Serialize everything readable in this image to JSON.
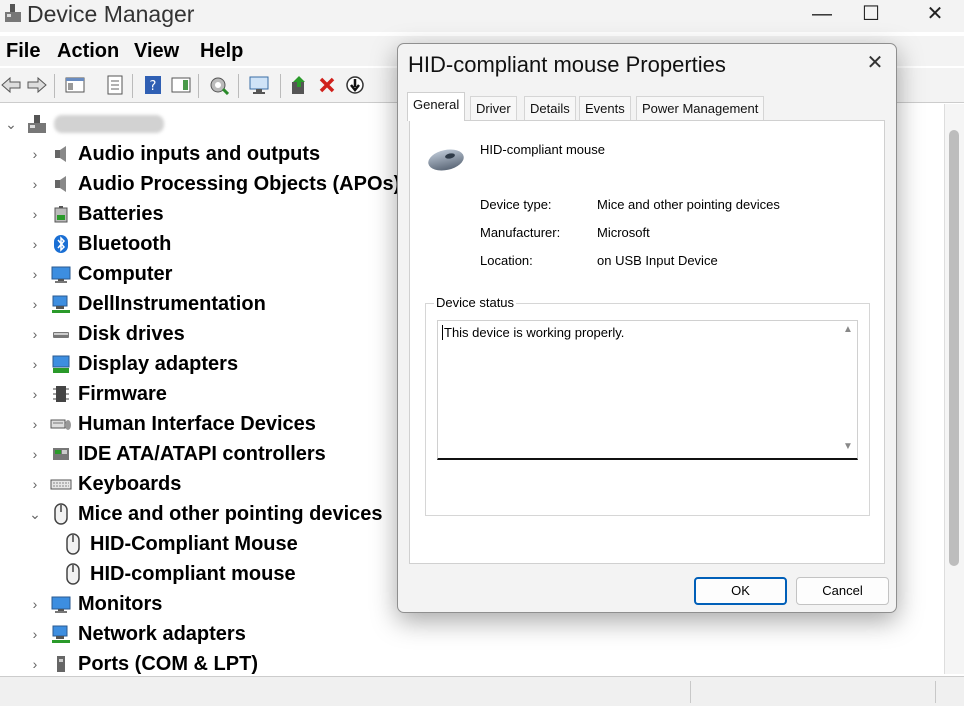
{
  "window": {
    "title": "Device Manager",
    "controls": [
      "—",
      "☐",
      "✕"
    ]
  },
  "menu": [
    "File",
    "Action",
    "View",
    "Help"
  ],
  "tree": {
    "root_label": "",
    "items": [
      {
        "label": "Audio inputs and outputs",
        "icon": "speaker-icon"
      },
      {
        "label": "Audio Processing Objects (APOs)",
        "icon": "speaker-icon"
      },
      {
        "label": "Batteries",
        "icon": "battery-icon"
      },
      {
        "label": "Bluetooth",
        "icon": "bluetooth-icon"
      },
      {
        "label": "Computer",
        "icon": "monitor-icon"
      },
      {
        "label": "DellInstrumentation",
        "icon": "network-icon"
      },
      {
        "label": "Disk drives",
        "icon": "disk-icon"
      },
      {
        "label": "Display adapters",
        "icon": "display-adapter-icon"
      },
      {
        "label": "Firmware",
        "icon": "chip-icon"
      },
      {
        "label": "Human Interface Devices",
        "icon": "hid-icon"
      },
      {
        "label": "IDE ATA/ATAPI controllers",
        "icon": "controller-icon"
      },
      {
        "label": "Keyboards",
        "icon": "keyboard-icon"
      },
      {
        "label": "Mice and other pointing devices",
        "icon": "mouse-icon",
        "expanded": true
      },
      {
        "label": "HID-Compliant Mouse",
        "icon": "mouse-icon",
        "child": true
      },
      {
        "label": "HID-compliant mouse",
        "icon": "mouse-icon",
        "child": true
      },
      {
        "label": "Monitors",
        "icon": "monitor-icon"
      },
      {
        "label": "Network adapters",
        "icon": "network-icon"
      },
      {
        "label": "Ports (COM & LPT)",
        "icon": "port-icon"
      }
    ]
  },
  "dialog": {
    "title": "HID-compliant mouse Properties",
    "tabs": [
      "General",
      "Driver",
      "Details",
      "Events",
      "Power Management"
    ],
    "active_tab": "General",
    "device_name": "HID-compliant mouse",
    "fields": [
      {
        "label": "Device type:",
        "value": "Mice and other pointing devices"
      },
      {
        "label": "Manufacturer:",
        "value": "Microsoft"
      },
      {
        "label": "Location:",
        "value": "on USB Input Device"
      }
    ],
    "status_legend": "Device status",
    "status_text": "This device is working properly.",
    "ok_label": "OK",
    "cancel_label": "Cancel"
  },
  "colors": {
    "accent": "#005fb8",
    "chrome": "#f3f3f3"
  }
}
